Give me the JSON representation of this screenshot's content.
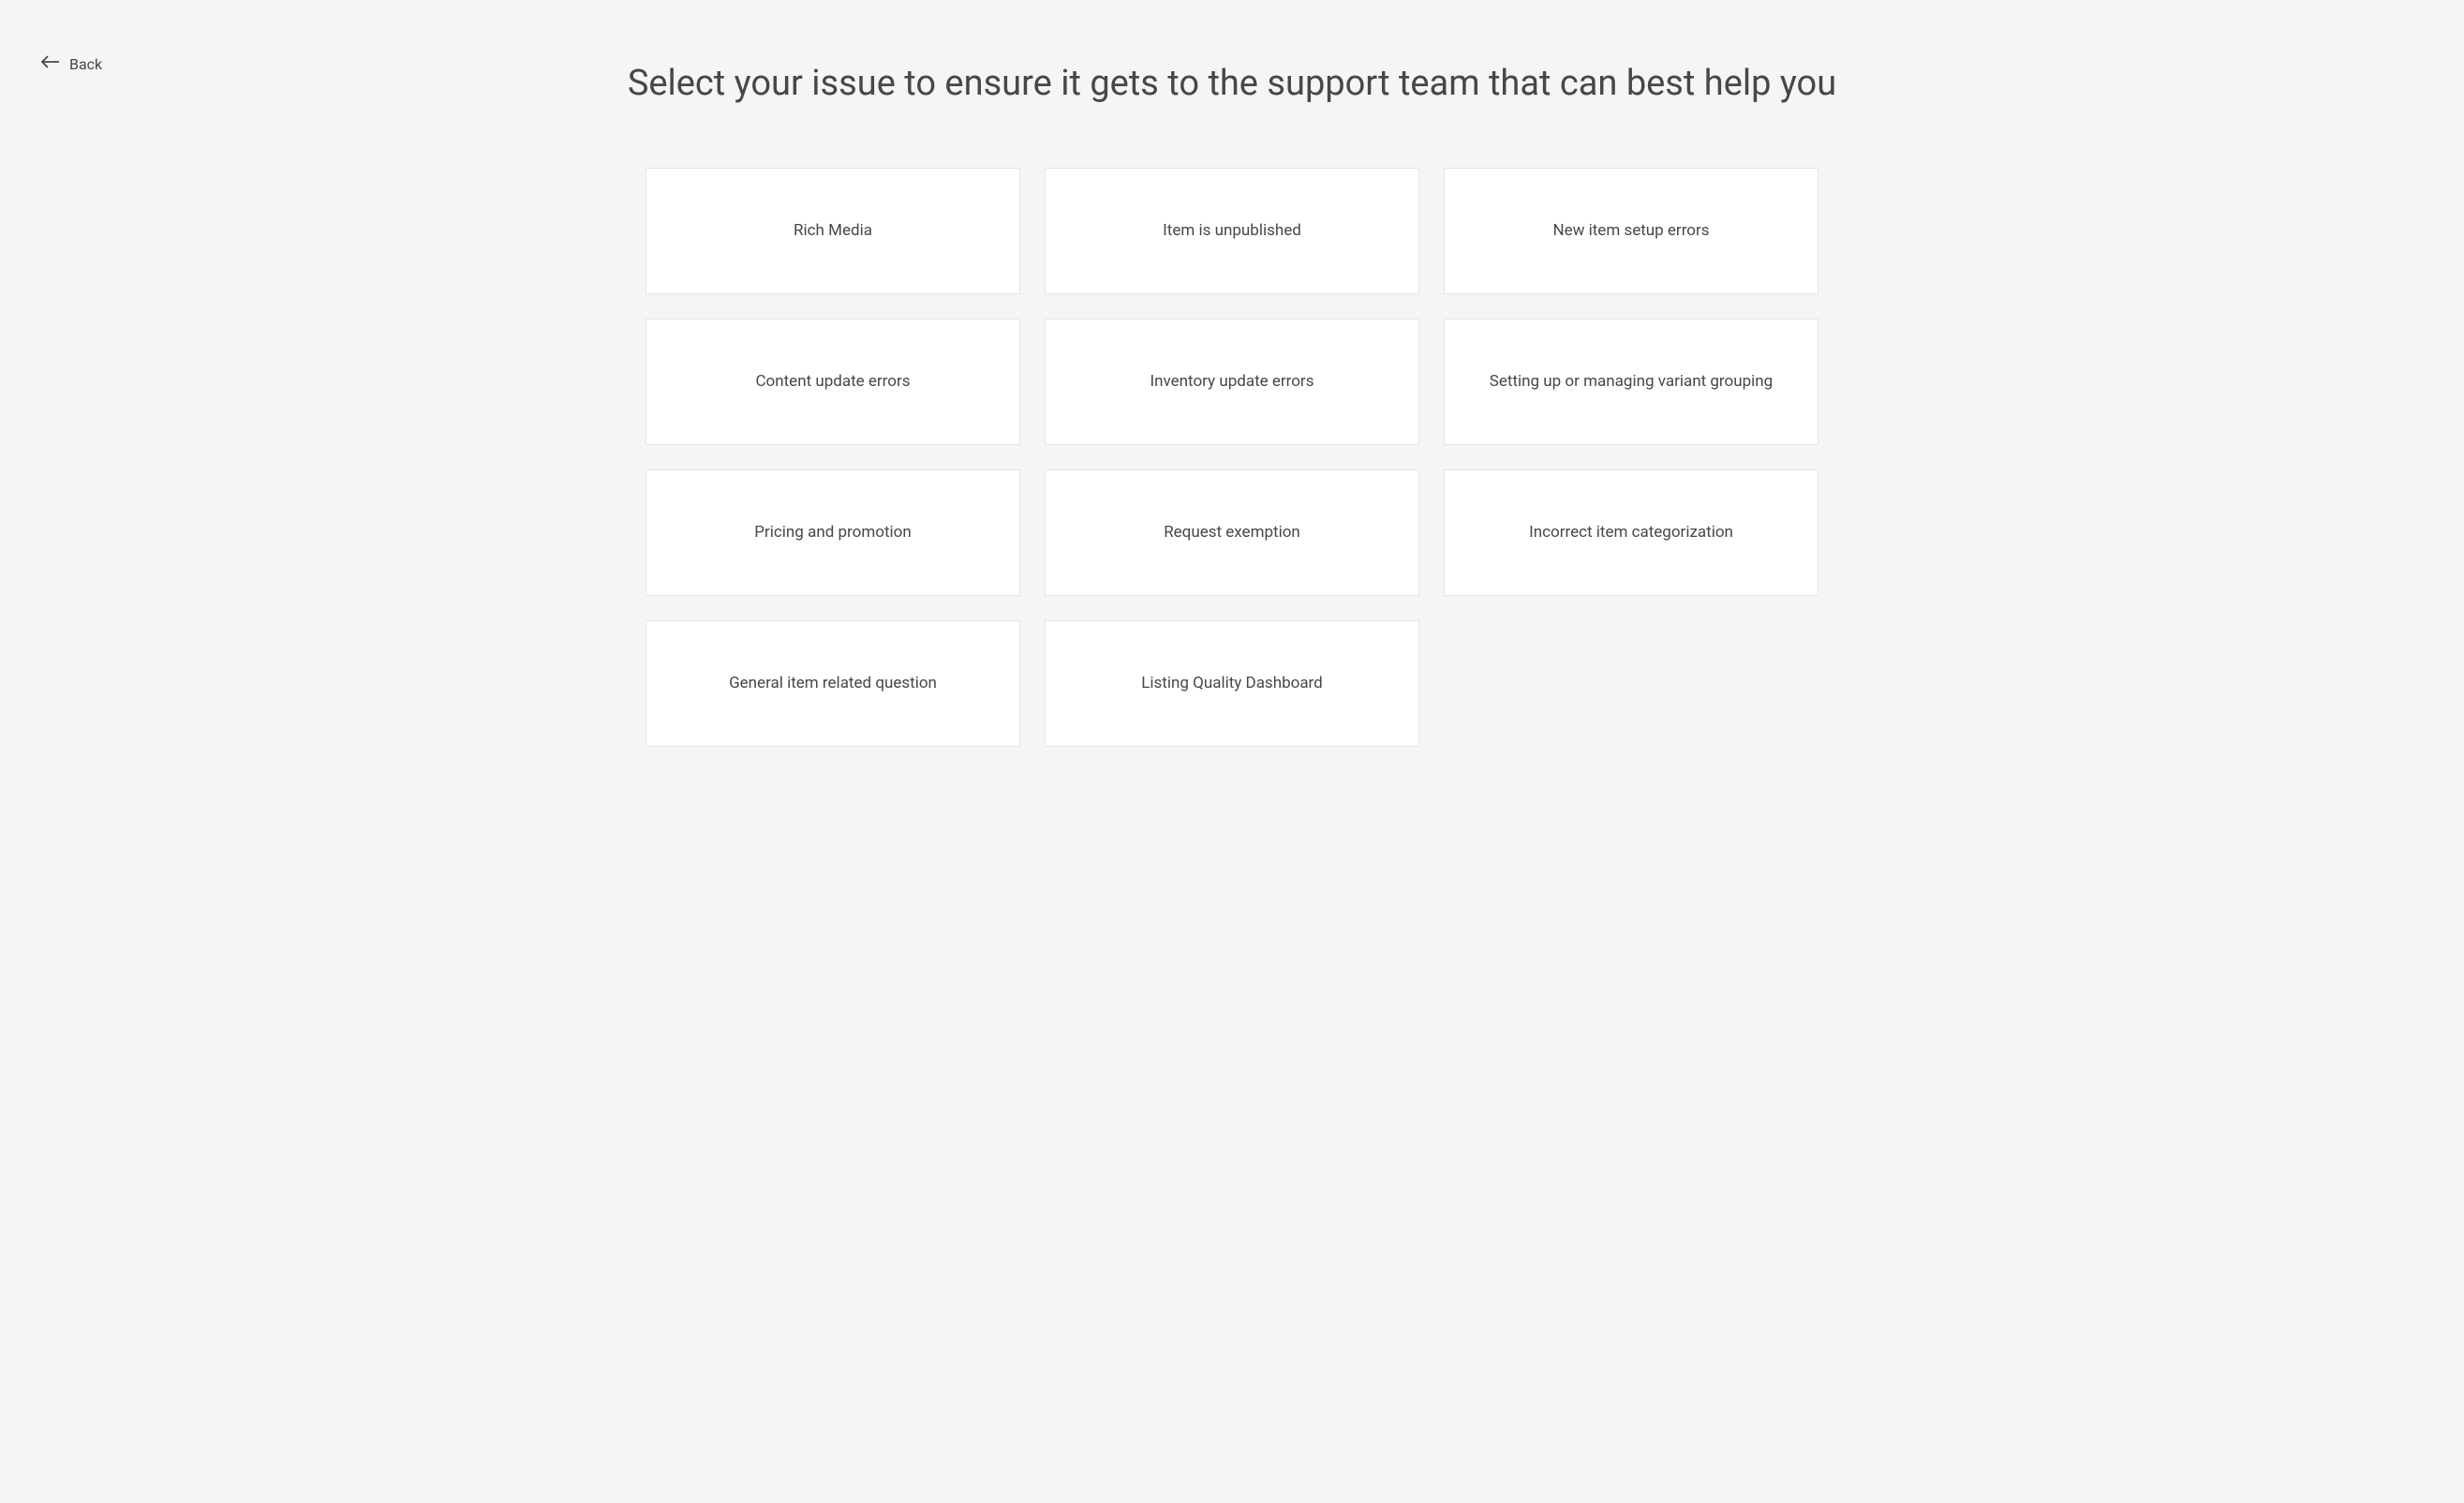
{
  "back": {
    "label": "Back"
  },
  "header": {
    "title": "Select your issue to ensure it gets to the support team that can best help you"
  },
  "issues": [
    {
      "label": "Rich Media"
    },
    {
      "label": "Item is unpublished"
    },
    {
      "label": "New item setup errors"
    },
    {
      "label": "Content update errors"
    },
    {
      "label": "Inventory update errors"
    },
    {
      "label": "Setting up or managing variant grouping"
    },
    {
      "label": "Pricing and promotion"
    },
    {
      "label": "Request exemption"
    },
    {
      "label": "Incorrect item categorization"
    },
    {
      "label": "General item related question"
    },
    {
      "label": "Listing Quality Dashboard"
    }
  ]
}
